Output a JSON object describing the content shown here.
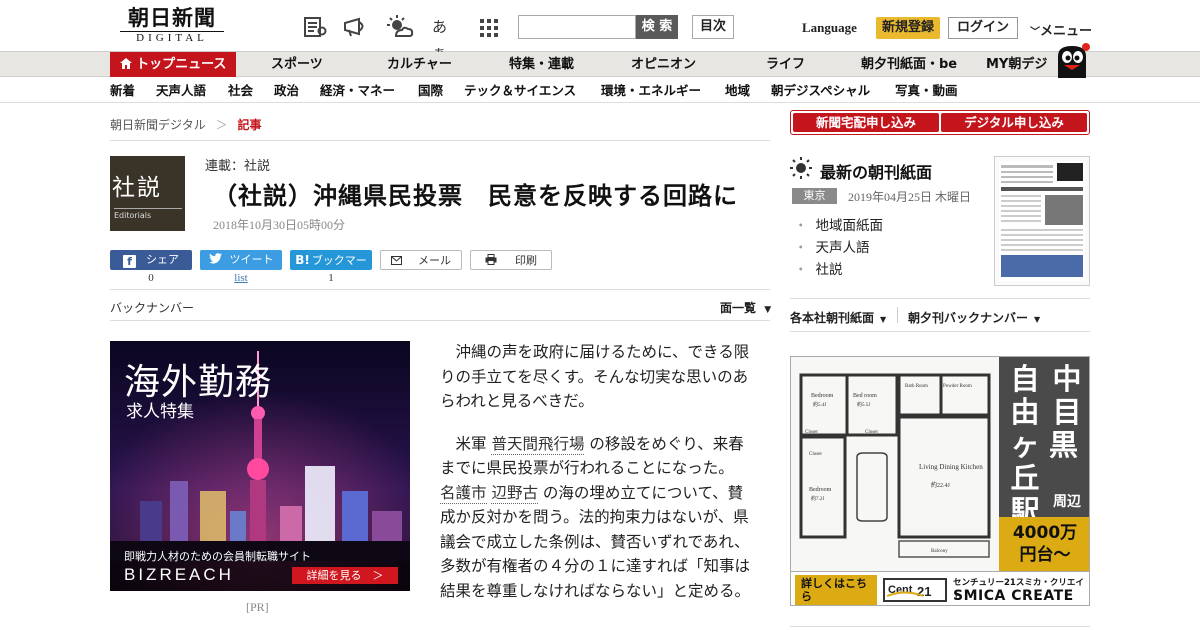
{
  "header": {
    "logo_jp": "朝日新聞",
    "logo_en": "DIGITAL",
    "toolbar_icons": [
      "newspaper-icon",
      "megaphone-icon",
      "weather-icon",
      "text-size-icon",
      "apps-grid-icon"
    ],
    "text_size_label": "あぁ",
    "search_placeholder": "",
    "search_button": "検 索",
    "index_button": "目次",
    "language": "Language",
    "register": "新規登録",
    "login": "ログイン",
    "menu": "メニュー"
  },
  "nav_primary": [
    "トップニュース",
    "スポーツ",
    "カルチャー",
    "特集・連載",
    "オピニオン",
    "ライフ",
    "朝夕刊紙面・be",
    "MY朝デジ"
  ],
  "nav_secondary": [
    "新着",
    "天声人語",
    "社会",
    "政治",
    "経済・マネー",
    "国際",
    "テック＆サイエンス",
    "環境・エネルギー",
    "地域",
    "朝デジスペシャル",
    "写真・動画"
  ],
  "breadcrumb": {
    "home": "朝日新聞デジタル",
    "sep": "＞",
    "current": "記事"
  },
  "article": {
    "thumb_kanji": "社説",
    "thumb_en": "Editorials",
    "series": "連載：社説",
    "title": "（社説）沖縄県民投票　民意を反映する回路に",
    "date": "2018年10月30日05時00分",
    "share": [
      {
        "label": "シェア",
        "count": "0"
      },
      {
        "label": "ツイート",
        "count": "list"
      },
      {
        "label": "ブックマーク",
        "count": "1"
      },
      {
        "label": "メール",
        "count": ""
      },
      {
        "label": "印刷",
        "count": ""
      }
    ],
    "backnumber": "バックナンバー",
    "list_toggle": "面一覧",
    "paragraphs": {
      "p1": "沖縄の声を政府に届けるために、できる限りの手立てを尽くす。そんな切実な思いのあらわれと見るべきだ。",
      "p2a": "米軍",
      "p2_link1": "普天間飛行場",
      "p2b": "の移設をめぐり、来春までに県民投票が行われることになった。",
      "p2_link2": "名護市",
      "p2_link3": "辺野古",
      "p2c": "の海の埋め立てについて、賛成か反対かを問う。法的拘束力はないが、県議会で成立した条例は、賛否いずれであれ、多数が有権者の４分の１に達すれば「知事は結果を尊重しなければならない」と定める。"
    }
  },
  "ad_left": {
    "heading": "海外勤務",
    "sub": "求人特集",
    "tagline": "即戦力人材のための会員制転職サイト",
    "brand": "BIZREACH",
    "cta": "詳細を見る　＞",
    "pr": "[PR]"
  },
  "sidebar": {
    "subscribe_paper": "新聞宅配申し込み",
    "subscribe_digital": "デジタル申し込み",
    "paper_title": "最新の朝刊紙面",
    "paper_city": "東京",
    "paper_date": "2019年04月25日 木曜日",
    "links": [
      "地域面紙面",
      "天声人語",
      "社説"
    ],
    "honsha": "各本社朝刊紙面",
    "yukan": "朝夕刊バックナンバー"
  },
  "ad_right": {
    "area1": "中目黒・",
    "area2": "自由ヶ丘駅",
    "area_suffix": "周辺",
    "price": "4000万円台～",
    "details": "詳しくはこちら",
    "brand": "SMICA CREATE",
    "brand_jp": "センチュリー21スミカ・クリエイト",
    "room_labels": [
      "Bedroom",
      "Bed room",
      "Bath Room",
      "Powder Room",
      "Closet",
      "Closet",
      "Closet",
      "Living Dining Kitchen",
      "Bedroom",
      "Balcony"
    ],
    "room_sizes": [
      "約5.4J",
      "約5.5J",
      "約22.4J",
      "約7.2J"
    ]
  },
  "colors": {
    "brand_red": "#c4151d",
    "register_yellow": "#ebb92d",
    "nav_bg": "#e7e6e2"
  }
}
